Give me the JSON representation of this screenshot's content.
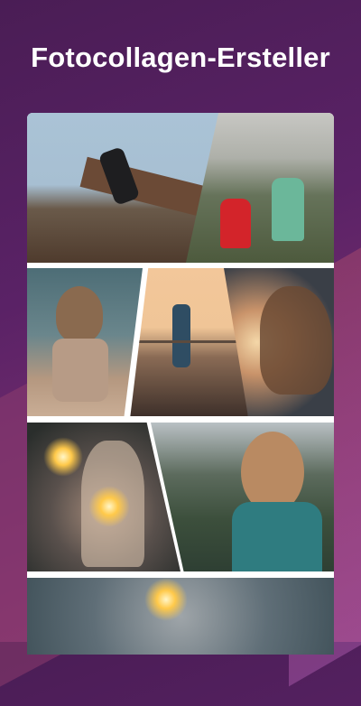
{
  "header": {
    "title": "Fotocollagen-Ersteller"
  },
  "collage": {
    "tiles": [
      {
        "name": "photo-jumping-man"
      },
      {
        "name": "photo-couple-field"
      },
      {
        "name": "photo-woman-sitting"
      },
      {
        "name": "photo-photographer-pier"
      },
      {
        "name": "photo-windblown-hair"
      },
      {
        "name": "photo-woman-sparklers"
      },
      {
        "name": "photo-woman-sunglasses"
      },
      {
        "name": "photo-sparkler-partial"
      }
    ]
  }
}
